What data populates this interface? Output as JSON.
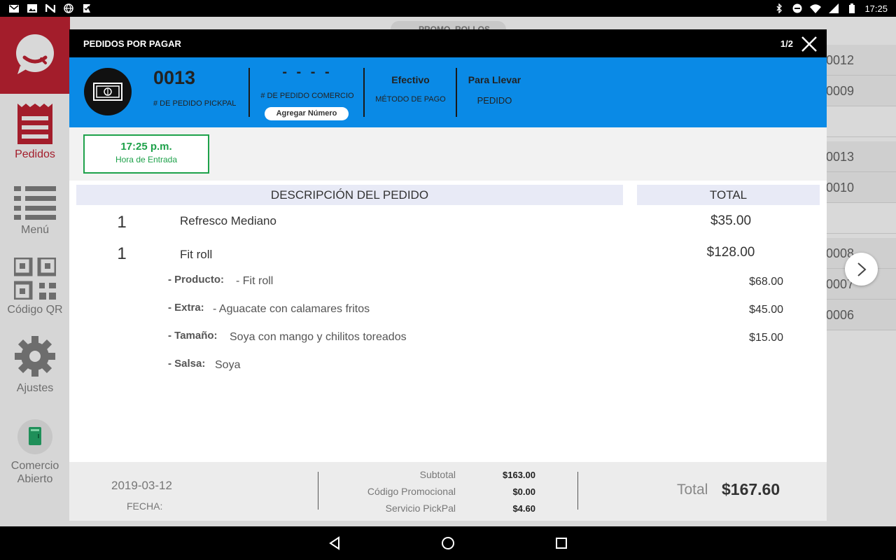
{
  "status_bar": {
    "time": "17:25"
  },
  "sidebar": {
    "items": [
      {
        "label": "Pedidos"
      },
      {
        "label": "Menú"
      },
      {
        "label": "Código QR"
      },
      {
        "label": "Ajustes"
      },
      {
        "label": "Comercio Abierto"
      }
    ]
  },
  "background": {
    "header_pill": "PROMO_ROLLOS",
    "order_rows": [
      "0012",
      "0009",
      "0013",
      "0010",
      "0008",
      "0007",
      "0006"
    ]
  },
  "modal": {
    "title": "PEDIDOS POR PAGAR",
    "page": "1/2",
    "order": {
      "pickpal_number": "0013",
      "pickpal_label": "# DE PEDIDO PICKPAL",
      "commerce_number": "- - - -",
      "commerce_label": "# DE PEDIDO COMERCIO",
      "add_number_button": "Agregar Número",
      "payment_method": "Efectivo",
      "payment_label": "MÉTODO DE PAGO",
      "order_type": "Para Llevar",
      "order_type_label": "PEDIDO"
    },
    "entry": {
      "time": "17:25 p.m.",
      "label": "Hora de Entrada"
    },
    "table_headers": {
      "description": "DESCRIPCIÓN DEL PEDIDO",
      "total": "TOTAL"
    },
    "items": [
      {
        "qty": "1",
        "name": "Refresco Mediano",
        "price": "$35.00"
      },
      {
        "qty": "1",
        "name": "Fit roll",
        "price": "$128.00"
      }
    ],
    "modifiers": [
      {
        "key": "- Producto:",
        "value": "- Fit roll",
        "price": "$68.00"
      },
      {
        "key": "- Extra:",
        "value": "- Aguacate con calamares fritos",
        "price": "$45.00"
      },
      {
        "key": "- Tamaño:",
        "value": "Soya con mango y chilitos toreados",
        "price": "$15.00"
      },
      {
        "key": "- Salsa:",
        "value": "Soya",
        "price": ""
      }
    ],
    "footer": {
      "date": "2019-03-12",
      "date_label": "FECHA:",
      "subtotal_label": "Subtotal",
      "subtotal": "$163.00",
      "promo_label": "Código Promocional",
      "promo": "$0.00",
      "service_label": "Servicio PickPal",
      "service": "$4.60",
      "total_label": "Total",
      "total": "$167.60"
    }
  },
  "colors": {
    "brand_red": "#a31d2b",
    "header_blue": "#0a8ae6",
    "entry_green": "#1ea14a"
  }
}
